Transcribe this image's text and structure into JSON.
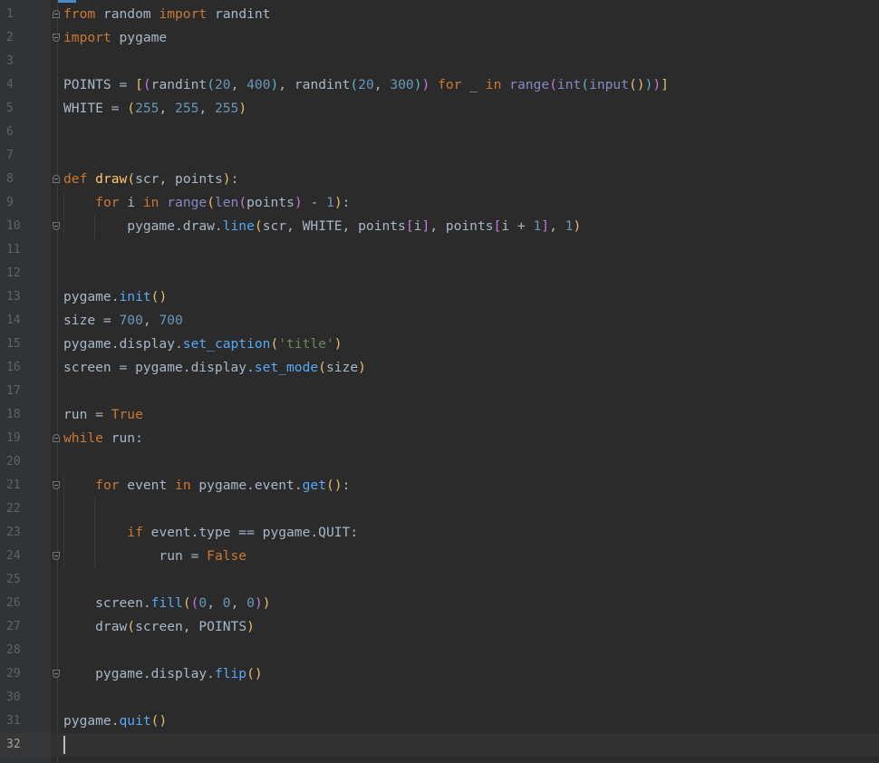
{
  "editor": {
    "language": "python",
    "current_line": 32,
    "colors": {
      "background": "#2b2b2b",
      "gutter": "#313335",
      "line_number": "#606366",
      "text": "#a9b7c6",
      "keyword": "#cc7832",
      "function_def": "#ffc66d",
      "number": "#6897bb",
      "builtin": "#8888c6",
      "string": "#6a8759",
      "method_call": "#56a8f5",
      "bracket_1": "#e8bf6a",
      "bracket_2": "#c678dd",
      "bracket_3": "#56b6c2"
    },
    "lines": [
      {
        "n": "1",
        "code": [
          [
            "kw",
            "from"
          ],
          [
            "df",
            " random "
          ],
          [
            "kw",
            "import"
          ],
          [
            "df",
            " randint"
          ]
        ]
      },
      {
        "n": "2",
        "code": [
          [
            "kw",
            "import"
          ],
          [
            "df",
            " pygame"
          ]
        ]
      },
      {
        "n": "3",
        "code": []
      },
      {
        "n": "4",
        "code": [
          [
            "df",
            "POINTS = "
          ],
          [
            "p1",
            "["
          ],
          [
            "p2",
            "("
          ],
          [
            "df",
            "randint"
          ],
          [
            "p3",
            "("
          ],
          [
            "nm",
            "20"
          ],
          [
            "df",
            ", "
          ],
          [
            "nm",
            "400"
          ],
          [
            "p3",
            ")"
          ],
          [
            "df",
            ", randint"
          ],
          [
            "p3",
            "("
          ],
          [
            "nm",
            "20"
          ],
          [
            "df",
            ", "
          ],
          [
            "nm",
            "300"
          ],
          [
            "p3",
            ")"
          ],
          [
            "p2",
            ")"
          ],
          [
            "df",
            " "
          ],
          [
            "kw",
            "for"
          ],
          [
            "df",
            " _ "
          ],
          [
            "kw",
            "in"
          ],
          [
            "df",
            " "
          ],
          [
            "bi",
            "range"
          ],
          [
            "p2",
            "("
          ],
          [
            "bi",
            "int"
          ],
          [
            "p3",
            "("
          ],
          [
            "bi",
            "input"
          ],
          [
            "p1",
            "()"
          ],
          [
            "p3",
            ")"
          ],
          [
            "p2",
            ")"
          ],
          [
            "p1",
            "]"
          ]
        ]
      },
      {
        "n": "5",
        "code": [
          [
            "df",
            "WHITE = "
          ],
          [
            "p1",
            "("
          ],
          [
            "nm",
            "255"
          ],
          [
            "df",
            ", "
          ],
          [
            "nm",
            "255"
          ],
          [
            "df",
            ", "
          ],
          [
            "nm",
            "255"
          ],
          [
            "p1",
            ")"
          ]
        ]
      },
      {
        "n": "6",
        "code": []
      },
      {
        "n": "7",
        "code": []
      },
      {
        "n": "8",
        "code": [
          [
            "kw",
            "def"
          ],
          [
            "df",
            " "
          ],
          [
            "fn",
            "draw"
          ],
          [
            "p1",
            "("
          ],
          [
            "df",
            "scr, points"
          ],
          [
            "p1",
            ")"
          ],
          [
            "df",
            ":"
          ]
        ]
      },
      {
        "n": "9",
        "code": [
          [
            "df",
            "    "
          ],
          [
            "kw",
            "for"
          ],
          [
            "df",
            " i "
          ],
          [
            "kw",
            "in"
          ],
          [
            "df",
            " "
          ],
          [
            "bi",
            "range"
          ],
          [
            "p1",
            "("
          ],
          [
            "bi",
            "len"
          ],
          [
            "p2",
            "("
          ],
          [
            "df",
            "points"
          ],
          [
            "p2",
            ")"
          ],
          [
            "df",
            " - "
          ],
          [
            "nm",
            "1"
          ],
          [
            "p1",
            ")"
          ],
          [
            "df",
            ":"
          ]
        ]
      },
      {
        "n": "10",
        "code": [
          [
            "df",
            "        pygame.draw."
          ],
          [
            "mc",
            "line"
          ],
          [
            "p1",
            "("
          ],
          [
            "df",
            "scr, WHITE, points"
          ],
          [
            "p2",
            "["
          ],
          [
            "df",
            "i"
          ],
          [
            "p2",
            "]"
          ],
          [
            "df",
            ", points"
          ],
          [
            "p2",
            "["
          ],
          [
            "df",
            "i + "
          ],
          [
            "nm",
            "1"
          ],
          [
            "p2",
            "]"
          ],
          [
            "df",
            ", "
          ],
          [
            "nm",
            "1"
          ],
          [
            "p1",
            ")"
          ]
        ]
      },
      {
        "n": "11",
        "code": []
      },
      {
        "n": "12",
        "code": []
      },
      {
        "n": "13",
        "code": [
          [
            "df",
            "pygame."
          ],
          [
            "mc",
            "init"
          ],
          [
            "p1",
            "()"
          ]
        ]
      },
      {
        "n": "14",
        "code": [
          [
            "df",
            "size = "
          ],
          [
            "nm",
            "700"
          ],
          [
            "df",
            ", "
          ],
          [
            "nm",
            "700"
          ]
        ]
      },
      {
        "n": "15",
        "code": [
          [
            "df",
            "pygame.display."
          ],
          [
            "mc",
            "set_caption"
          ],
          [
            "p1",
            "("
          ],
          [
            "st",
            "'title'"
          ],
          [
            "p1",
            ")"
          ]
        ]
      },
      {
        "n": "16",
        "code": [
          [
            "df",
            "screen = pygame.display."
          ],
          [
            "mc",
            "set_mode"
          ],
          [
            "p1",
            "("
          ],
          [
            "df",
            "size"
          ],
          [
            "p1",
            ")"
          ]
        ]
      },
      {
        "n": "17",
        "code": []
      },
      {
        "n": "18",
        "code": [
          [
            "df",
            "run = "
          ],
          [
            "kw",
            "True"
          ]
        ]
      },
      {
        "n": "19",
        "code": [
          [
            "kw",
            "while"
          ],
          [
            "df",
            " run:"
          ]
        ]
      },
      {
        "n": "20",
        "code": []
      },
      {
        "n": "21",
        "code": [
          [
            "df",
            "    "
          ],
          [
            "kw",
            "for"
          ],
          [
            "df",
            " event "
          ],
          [
            "kw",
            "in"
          ],
          [
            "df",
            " pygame.event."
          ],
          [
            "mc",
            "get"
          ],
          [
            "p1",
            "()"
          ],
          [
            "df",
            ":"
          ]
        ]
      },
      {
        "n": "22",
        "code": []
      },
      {
        "n": "23",
        "code": [
          [
            "df",
            "        "
          ],
          [
            "kw",
            "if"
          ],
          [
            "df",
            " event.type == pygame.QUIT:"
          ]
        ]
      },
      {
        "n": "24",
        "code": [
          [
            "df",
            "            run = "
          ],
          [
            "kw",
            "False"
          ]
        ]
      },
      {
        "n": "25",
        "code": []
      },
      {
        "n": "26",
        "code": [
          [
            "df",
            "    screen."
          ],
          [
            "mc",
            "fill"
          ],
          [
            "p1",
            "("
          ],
          [
            "p2",
            "("
          ],
          [
            "nm",
            "0"
          ],
          [
            "df",
            ", "
          ],
          [
            "nm",
            "0"
          ],
          [
            "df",
            ", "
          ],
          [
            "nm",
            "0"
          ],
          [
            "p2",
            ")"
          ],
          [
            "p1",
            ")"
          ]
        ]
      },
      {
        "n": "27",
        "code": [
          [
            "df",
            "    draw"
          ],
          [
            "p1",
            "("
          ],
          [
            "df",
            "screen, POINTS"
          ],
          [
            "p1",
            ")"
          ]
        ]
      },
      {
        "n": "28",
        "code": []
      },
      {
        "n": "29",
        "code": [
          [
            "df",
            "    pygame.display."
          ],
          [
            "mc",
            "flip"
          ],
          [
            "p1",
            "()"
          ]
        ]
      },
      {
        "n": "30",
        "code": []
      },
      {
        "n": "31",
        "code": [
          [
            "df",
            "pygame."
          ],
          [
            "mc",
            "quit"
          ],
          [
            "p1",
            "()"
          ]
        ]
      },
      {
        "n": "32",
        "code": []
      }
    ]
  }
}
